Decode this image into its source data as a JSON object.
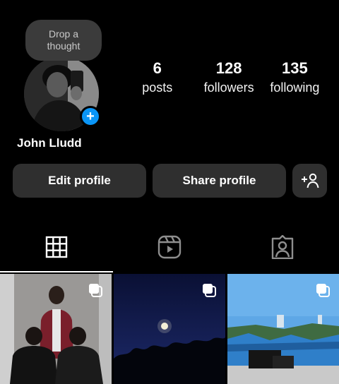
{
  "profile": {
    "thought_bubble": "Drop a thought",
    "name": "John Lludd",
    "stats": {
      "posts_count": "6",
      "posts_label": "posts",
      "followers_count": "128",
      "followers_label": "followers",
      "following_count": "135",
      "following_label": "following"
    }
  },
  "buttons": {
    "edit_profile": "Edit profile",
    "share_profile": "Share profile"
  },
  "tabs": [
    {
      "name": "grid",
      "icon": "grid-icon",
      "active": true
    },
    {
      "name": "reels",
      "icon": "reels-icon",
      "active": false
    },
    {
      "name": "tagged",
      "icon": "tagged-person-icon",
      "active": false
    }
  ],
  "posts": [
    {
      "icon": "multiple-photos-icon"
    },
    {
      "icon": "multiple-photos-icon"
    },
    {
      "icon": "multiple-photos-icon"
    }
  ],
  "colors": {
    "background": "#000000",
    "button": "#2f2f2f",
    "accent": "#0a95f6"
  }
}
